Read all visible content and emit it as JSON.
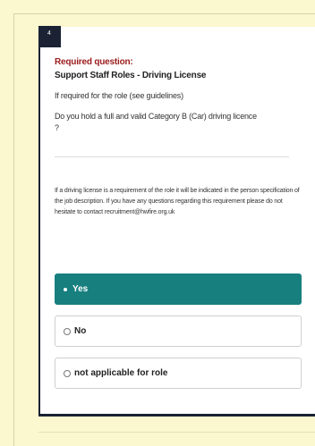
{
  "question": {
    "number": "4",
    "required_label": "Required question:",
    "title": "Support Staff Roles - Driving License",
    "hint": "If required for the role (see guidelines)",
    "text": "Do you hold a full and valid Category B (Car) driving licence ?",
    "info": "If a driving license is a requirement of the role it will be indicated in the person specification of the job description. If you have any questions regarding this requirement please do not hesitate to contact recruitment@hwfire.org.uk",
    "options": [
      {
        "label": "Yes",
        "selected": true
      },
      {
        "label": "No",
        "selected": false
      },
      {
        "label": "not applicable for role",
        "selected": false
      }
    ]
  },
  "colors": {
    "selected_accent": "#187f7f",
    "required_text": "#9b1b1b",
    "badge": "#1a2234",
    "page_background": "#fbf7cf"
  },
  "icons": {
    "selected_marker": "radio-selected-icon",
    "unselected_marker": "radio-unselected-icon"
  }
}
